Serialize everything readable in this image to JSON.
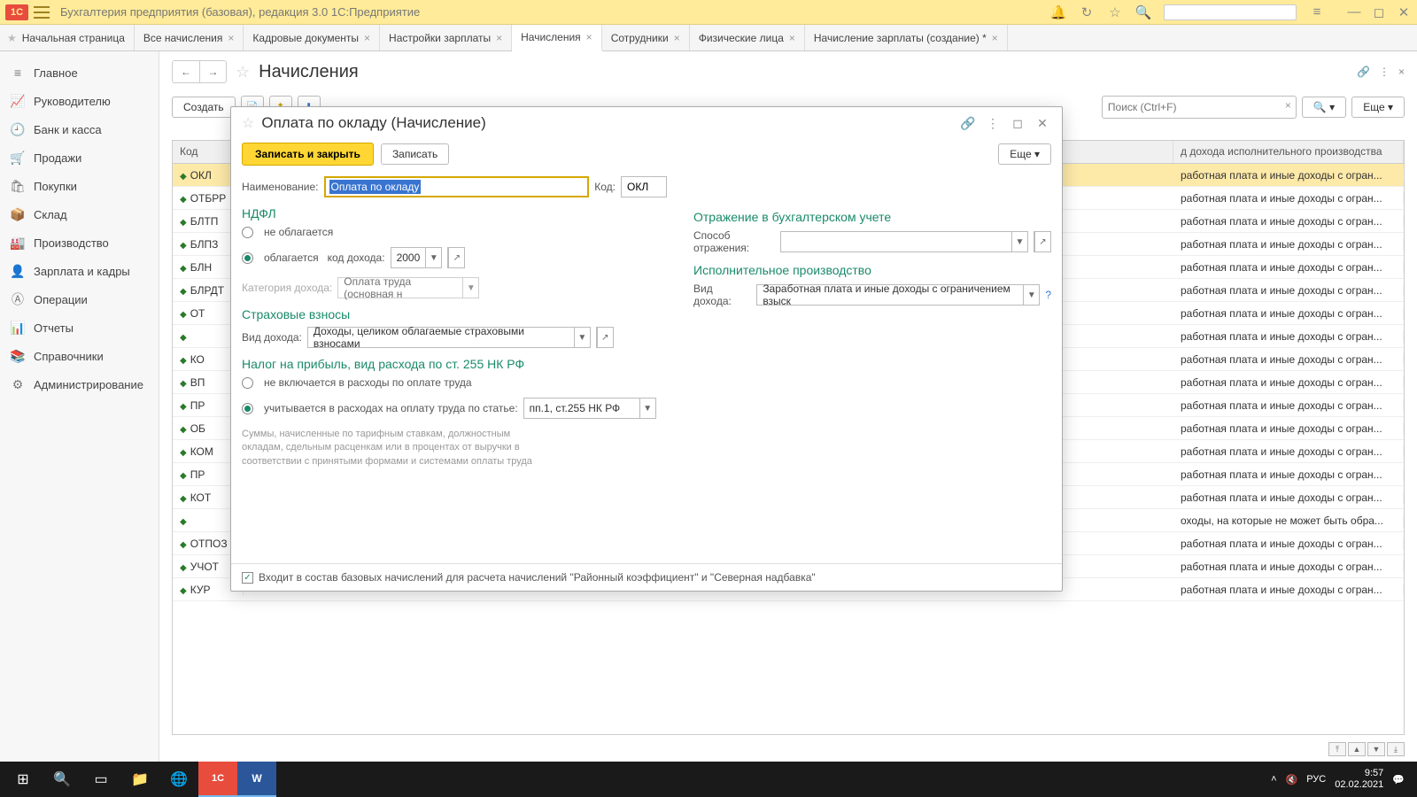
{
  "titlebar": {
    "title": "Бухгалтерия предприятия (базовая), редакция 3.0  1С:Предприятие",
    "logo": "1C"
  },
  "tabs": [
    {
      "label": "Начальная страница",
      "home": true
    },
    {
      "label": "Все начисления"
    },
    {
      "label": "Кадровые документы"
    },
    {
      "label": "Настройки зарплаты"
    },
    {
      "label": "Начисления",
      "active": true
    },
    {
      "label": "Сотрудники"
    },
    {
      "label": "Физические лица"
    },
    {
      "label": "Начисление зарплаты (создание) *"
    }
  ],
  "sidebar": [
    {
      "icon": "≡",
      "label": "Главное"
    },
    {
      "icon": "📈",
      "label": "Руководителю"
    },
    {
      "icon": "🕘",
      "label": "Банк и касса"
    },
    {
      "icon": "🛒",
      "label": "Продажи"
    },
    {
      "icon": "🛍",
      "label": "Покупки"
    },
    {
      "icon": "📦",
      "label": "Склад"
    },
    {
      "icon": "🏭",
      "label": "Производство"
    },
    {
      "icon": "👤",
      "label": "Зарплата и кадры"
    },
    {
      "icon": "Ⓐ",
      "label": "Операции"
    },
    {
      "icon": "📊",
      "label": "Отчеты"
    },
    {
      "icon": "📚",
      "label": "Справочники"
    },
    {
      "icon": "⚙",
      "label": "Администрирование"
    }
  ],
  "page": {
    "title": "Начисления",
    "create": "Создать",
    "search_placeholder": "Поиск (Ctrl+F)",
    "more": "Еще ▾"
  },
  "grid": {
    "head_code": "Код",
    "head_right": "д дохода исполнительного производства",
    "right_text": "работная плата и иные доходы с огран...",
    "right_text_alt": "оходы, на которые не может быть обра...",
    "codes": [
      "ОКЛ",
      "ОТБРР",
      "БЛТП",
      "БЛПЗ",
      "БЛН",
      "БЛРДТ",
      "ОТ",
      "",
      "КО",
      "ВП",
      "ПР",
      "ОБ",
      "КОМ",
      "ПР",
      "КОТ",
      "",
      "ОТПОЗ",
      "УЧОТ",
      "КУР"
    ]
  },
  "dialog": {
    "title": "Оплата по окладу (Начисление)",
    "save_close": "Записать и закрыть",
    "save": "Записать",
    "more": "Еще ▾",
    "name_label": "Наименование:",
    "name_value": "Оплата по окладу",
    "code_label": "Код:",
    "code_value": "ОКЛ",
    "ndfl": "НДФЛ",
    "ndfl_no": "не облагается",
    "ndfl_yes": "облагается",
    "income_code_label": "код дохода:",
    "income_code": "2000",
    "category_label": "Категория дохода:",
    "category_value": "Оплата труда (основная н",
    "insurance": "Страховые взносы",
    "income_type_label": "Вид дохода:",
    "income_type_value": "Доходы, целиком облагаемые страховыми взносами",
    "profit_tax": "Налог на прибыль, вид расхода по ст. 255 НК РФ",
    "profit_no": "не включается в расходы по оплате труда",
    "profit_yes": "учитывается в расходах на оплату труда по статье:",
    "profit_article": "пп.1, ст.255 НК РФ",
    "hint": "Суммы, начисленные по тарифным ставкам, должностным окладам, сдельным расценкам или в процентах от выручки в соответствии с принятыми формами и системами оплаты труда",
    "accounting": "Отражение в бухгалтерском учете",
    "reflection_label": "Способ отражения:",
    "enforcement": "Исполнительное производство",
    "enf_type_label": "Вид дохода:",
    "enf_type_value": "Заработная плата и иные доходы с ограничением взыск",
    "foot_check": "Входит в состав базовых начислений для расчета начислений \"Районный коэффициент\" и \"Северная надбавка\""
  },
  "tray": {
    "lang": "РУС",
    "time": "9:57",
    "date": "02.02.2021"
  }
}
